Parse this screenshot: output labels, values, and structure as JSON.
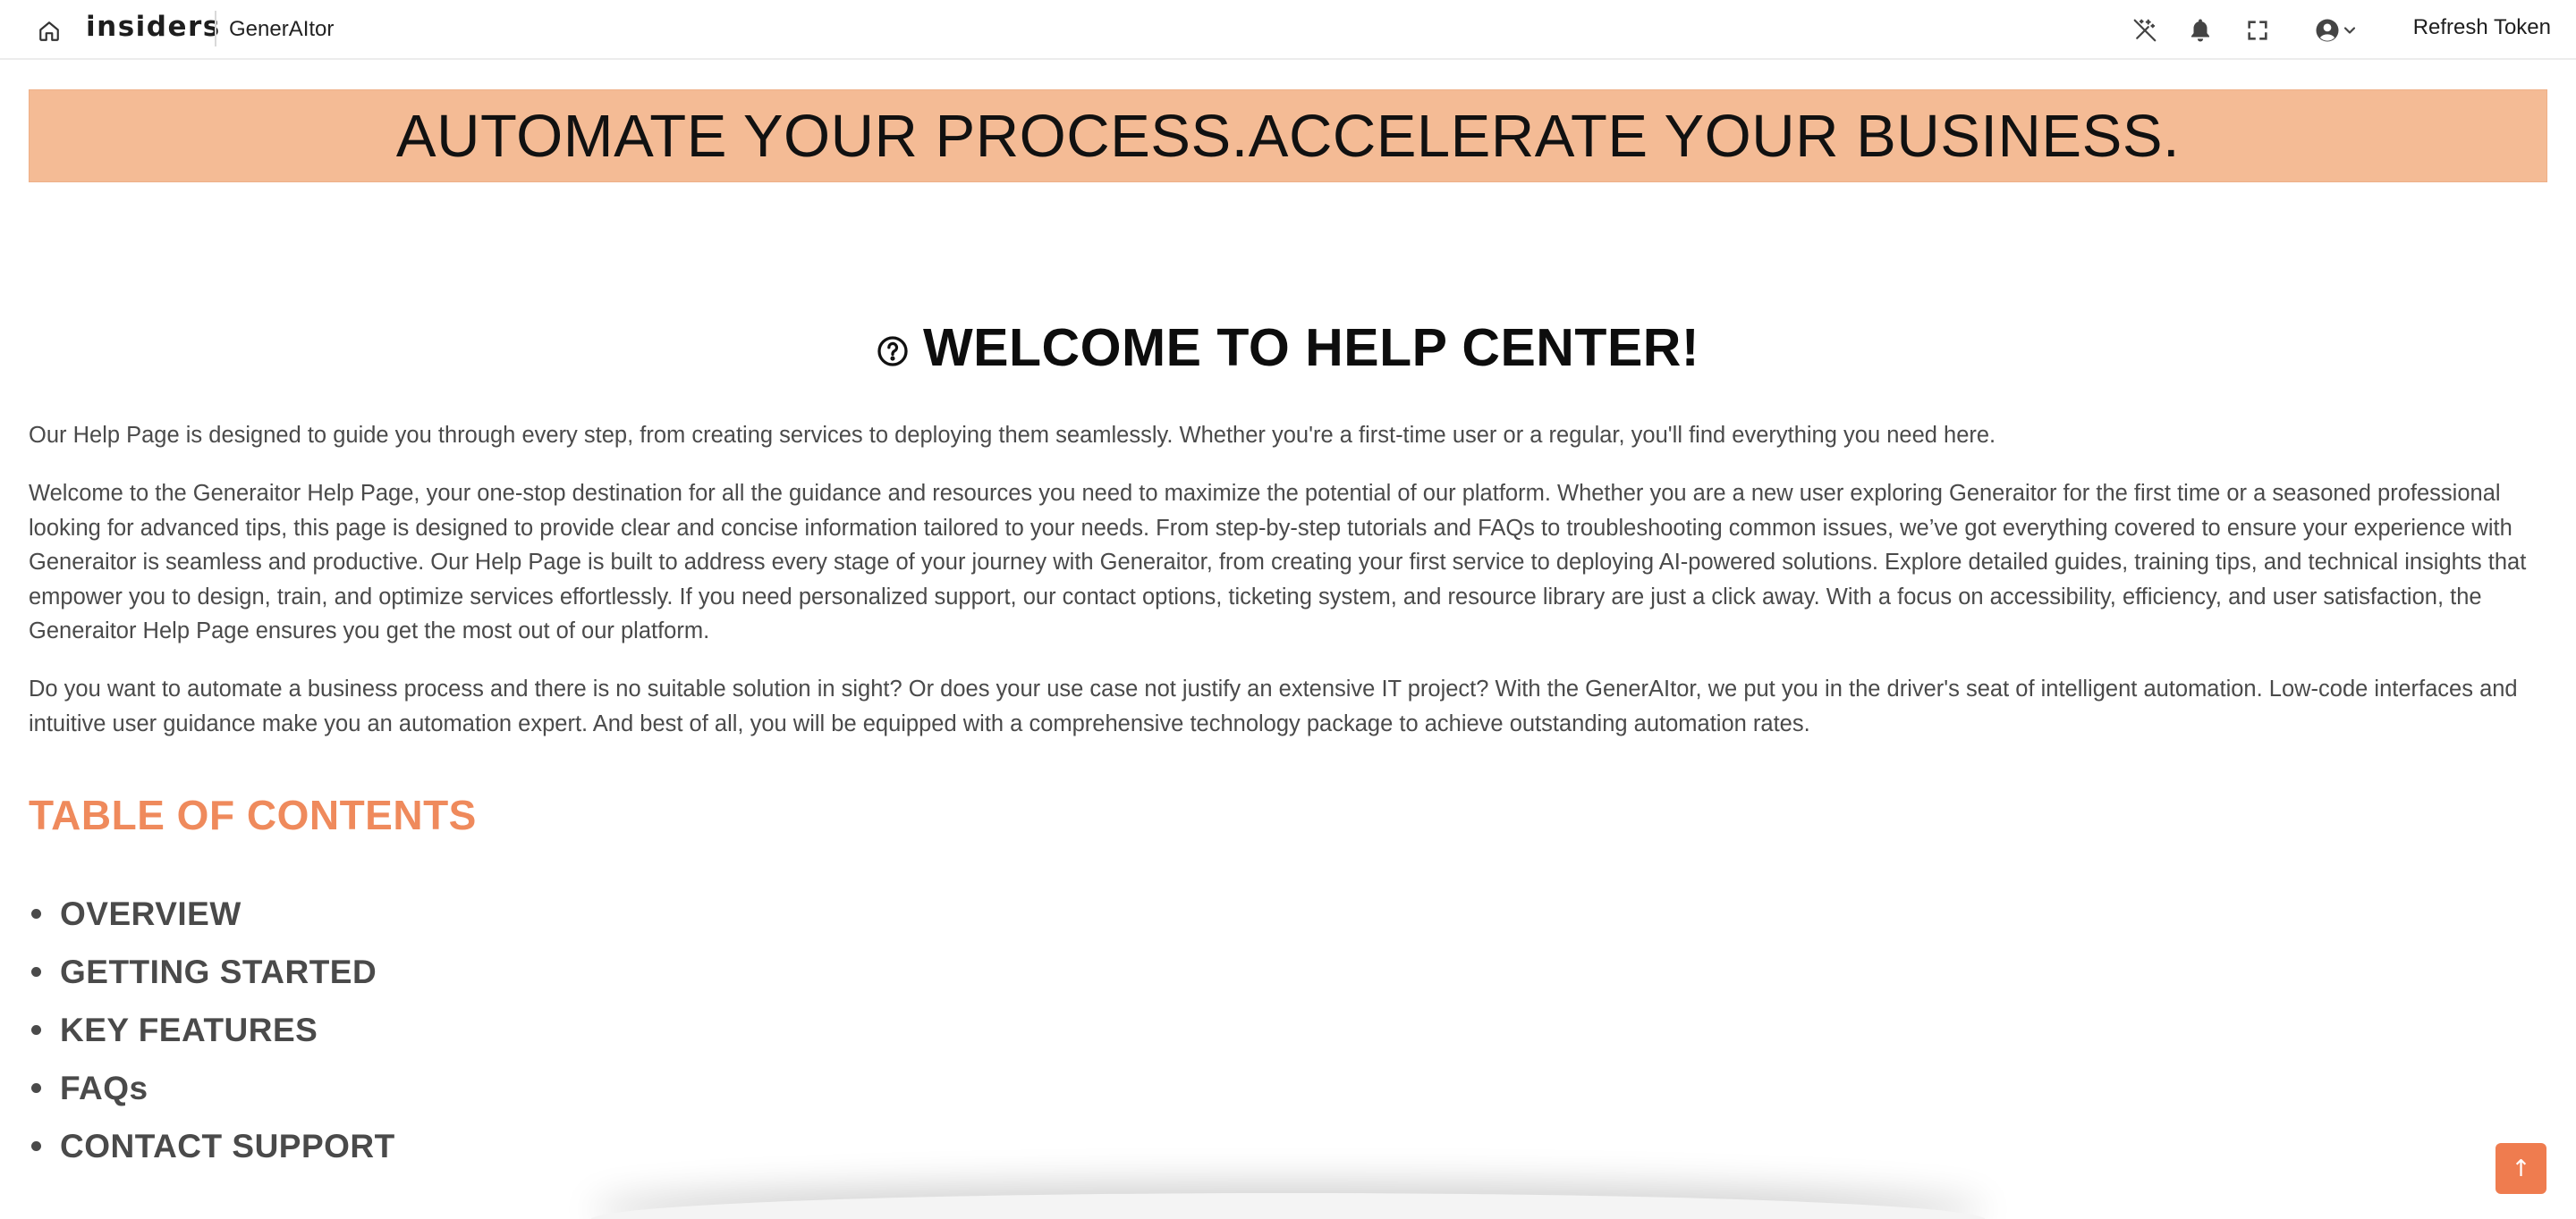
{
  "topbar": {
    "brand": "insiders",
    "app_name": "GenerAItor",
    "refresh_label": "Refresh Token",
    "icons": [
      "home-icon",
      "magic-wand-off-icon",
      "bell-icon",
      "fullscreen-icon",
      "user-circle-icon",
      "chevron-down-icon"
    ]
  },
  "banner": {
    "text": "AUTOMATE YOUR PROCESS.ACCELERATE YOUR BUSINESS.",
    "color": "#f4bb95"
  },
  "main": {
    "title": "WELCOME TO HELP CENTER!",
    "title_icon": "question-circle-icon",
    "paragraphs": [
      "Our Help Page is designed to guide you through every step, from creating services to deploying them seamlessly. Whether you're a first-time user or a regular, you'll find everything you need here.",
      "Welcome to the Generaitor Help Page, your one-stop destination for all the guidance and resources you need to maximize the potential of our platform. Whether you are a new user exploring Generaitor for the first time or a seasoned professional looking for advanced tips, this page is designed to provide clear and concise information tailored to your needs. From step-by-step tutorials and FAQs to troubleshooting common issues, we’ve got everything covered to ensure your experience with Generaitor is seamless and productive. Our Help Page is built to address every stage of your journey with Generaitor, from creating your first service to deploying AI-powered solutions. Explore detailed guides, training tips, and technical insights that empower you to design, train, and optimize services effortlessly. If you need personalized support, our contact options, ticketing system, and resource library are just a click away. With a focus on accessibility, efficiency, and user satisfaction, the Generaitor Help Page ensures you get the most out of our platform.",
      "Do you want to automate a business process and there is no suitable solution in sight? Or does your use case not justify an extensive IT project? With the GenerAItor, we put you in the driver's seat of intelligent automation. Low-code interfaces and intuitive user guidance make you an automation expert. And best of all, you will be equipped with a comprehensive technology package to achieve outstanding automation rates."
    ]
  },
  "toc": {
    "title": "TABLE OF CONTENTS",
    "title_color": "#ef8a5c",
    "items": [
      "OVERVIEW",
      "GETTING STARTED",
      "KEY FEATURES",
      "FAQs",
      "CONTACT SUPPORT"
    ]
  },
  "scroll_top": {
    "label": "↑",
    "color": "#ef7c4f"
  }
}
